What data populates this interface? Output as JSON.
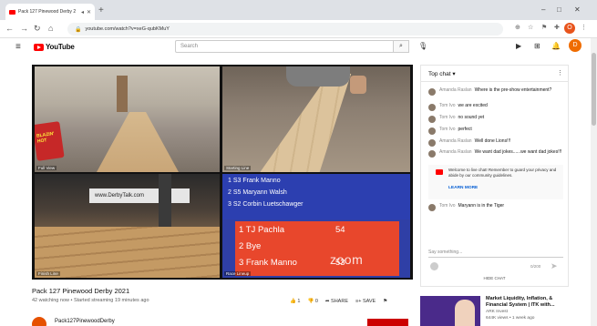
{
  "browser": {
    "tab_title": "Pack 127 Pinewood Derby 2",
    "url": "youtube.com/watch?v=xeG-qubKMuY",
    "tab_volume_icon": "speaker-icon",
    "window_controls": [
      "–",
      "□",
      "✕"
    ],
    "profile_initial": "O"
  },
  "youtube": {
    "logo_text": "YouTube",
    "search_placeholder": "Search",
    "avatar_initial": "D"
  },
  "player": {
    "quadrants": [
      {
        "label": "Full View"
      },
      {
        "label": "Starting Line"
      },
      {
        "label": "Finish Line",
        "banner": "www.DerbyTalk.com"
      },
      {
        "label": "Race Lineup"
      }
    ],
    "snack_text": "BLAZIN' HOT",
    "scoreboard": {
      "lanes": [
        {
          "text": "1 S3 Frank Manno"
        },
        {
          "text": "2 S5 Maryann Walsh"
        },
        {
          "text": "3 S2 Corbin Luetschawger"
        }
      ],
      "results": [
        {
          "place": "1 TJ Pachla",
          "score": "54"
        },
        {
          "place": "2 Bye",
          "score": ""
        },
        {
          "place": "3 Frank Manno",
          "score": "53"
        }
      ],
      "watermark": "zoom"
    }
  },
  "video": {
    "title": "Pack 127 Pinewood Derby 2021",
    "meta": "42 watching now • Started streaming 19 minutes ago",
    "likes": "1",
    "dislikes": "0",
    "share_label": "SHARE",
    "save_label": "SAVE",
    "channel_name": "Pack127PinewoodDerby"
  },
  "chat": {
    "header": "Top chat",
    "messages": [
      {
        "author": "Amanda Raslan",
        "text": "Where is the pre-show entertainment?"
      },
      {
        "author": "Tom Ivo",
        "text": "we are excited"
      },
      {
        "author": "Tom Ivo",
        "text": "no sound yet"
      },
      {
        "author": "Tom Ivo",
        "text": "perfect"
      },
      {
        "author": "Amanda Raslan",
        "text": "Well done Lions!!!"
      },
      {
        "author": "Amanda Raslan",
        "text": "We want dad jokes......we want dad jokes!!!"
      }
    ],
    "notice": "Welcome to live chat! Remember to guard your privacy and abide by our community guidelines.",
    "learn_more": "LEARN MORE",
    "last_message": {
      "author": "Tom Ivo",
      "text": "Maryann is in the Tiger"
    },
    "input_placeholder": "Say something...",
    "char_count": "0/200",
    "hide_chat": "HIDE CHAT"
  },
  "recommendation": {
    "title": "Market Liquidity, Inflation, & Financial System | ITK with...",
    "channel": "ARK Invest",
    "views": "644K views • 1 week ago"
  }
}
